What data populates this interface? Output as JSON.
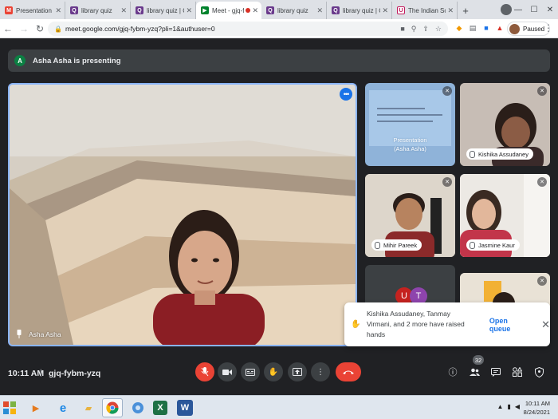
{
  "browser": {
    "tabs": [
      {
        "title": "Presentation sha",
        "icon": "gmail-icon",
        "color": "#ea4335",
        "glyph": "M",
        "active": false
      },
      {
        "title": "library quiz",
        "icon": "quizizz-icon",
        "color": "#6a3a8c",
        "glyph": "Q",
        "active": false
      },
      {
        "title": "library quiz | Oth",
        "icon": "quizizz-icon",
        "color": "#6a3a8c",
        "glyph": "Q",
        "active": false
      },
      {
        "title": "Meet - gjq-fy",
        "icon": "meet-icon",
        "color": "#00832d",
        "glyph": "▶",
        "active": true
      },
      {
        "title": "library quiz",
        "icon": "quizizz-icon",
        "color": "#6a3a8c",
        "glyph": "Q",
        "active": false
      },
      {
        "title": "library quiz | Oth",
        "icon": "quizizz-icon",
        "color": "#6a3a8c",
        "glyph": "Q",
        "active": false
      },
      {
        "title": "The Indian Schoo",
        "icon": "school-icon",
        "color": "#c2185b",
        "glyph": "U",
        "active": false
      }
    ],
    "url": "meet.google.com/gjq-fybm-yzq?pli=1&authuser=0",
    "profile_status": "Paused"
  },
  "meet": {
    "presenting_banner": "Asha Asha is presenting",
    "presenter_initial": "A",
    "main_participant": "Asha Asha",
    "tiles": {
      "presentation": "Presentation",
      "presentation_by": "(Asha Asha)",
      "kishika": "Kishika Assudaney",
      "mihir": "Mihir Pareek",
      "jasmine": "Jasmine Kaur",
      "initial_u": "U",
      "initial_t": "T"
    },
    "notification": {
      "message": "Kishika Assudaney, Tanmay Virmani, and 2 more have raised hands",
      "action": "Open queue"
    },
    "time": "10:11 AM",
    "separator": "|",
    "meeting_code": "gjq-fybm-yzq",
    "participant_count": "32"
  },
  "taskbar": {
    "time": "10:11 AM",
    "date": "8/24/2021"
  },
  "colors": {
    "accent_blue": "#1a73e8",
    "end_call_red": "#ea4335",
    "meet_bg": "#202124"
  }
}
